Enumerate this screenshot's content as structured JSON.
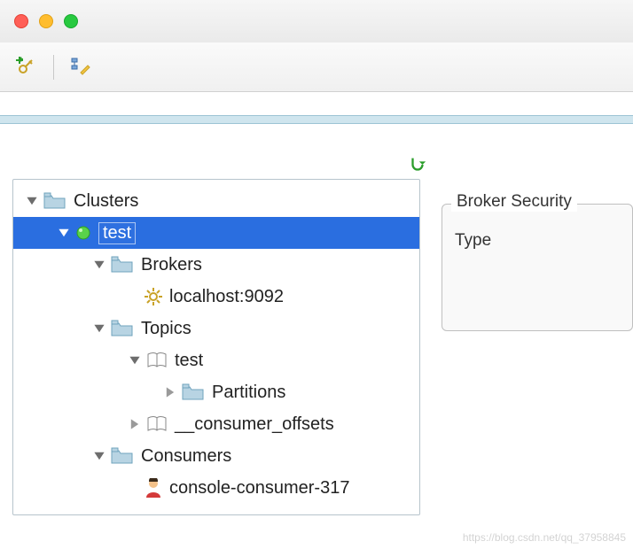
{
  "titlebar": {
    "close": "close",
    "minimize": "minimize",
    "zoom": "zoom"
  },
  "toolbar": {
    "add_key_icon": "add-key-icon",
    "edit_tree_icon": "edit-tree-icon",
    "refresh_icon": "refresh-icon"
  },
  "tree": {
    "root": {
      "label": "Clusters"
    },
    "cluster": {
      "label": "test"
    },
    "brokers": {
      "label": "Brokers",
      "items": [
        {
          "label": "localhost:9092"
        }
      ]
    },
    "topics": {
      "label": "Topics",
      "items": [
        {
          "label": "test",
          "partitions_label": "Partitions"
        },
        {
          "label": "__consumer_offsets"
        }
      ]
    },
    "consumers": {
      "label": "Consumers",
      "items": [
        {
          "label": "console-consumer-317"
        }
      ]
    }
  },
  "side": {
    "group_title": "Broker Security",
    "row1_label": "Type"
  },
  "watermark": "https://blog.csdn.net/qq_37958845"
}
